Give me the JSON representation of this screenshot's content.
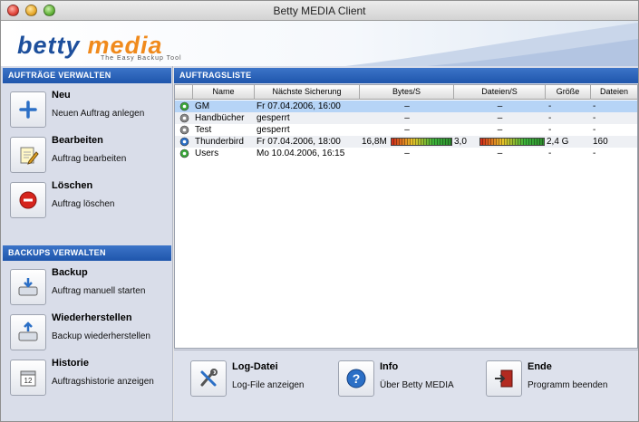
{
  "window": {
    "title": "Betty MEDIA Client"
  },
  "banner": {
    "logo_part1": "betty",
    "logo_part2": "media",
    "tagline": "The Easy Backup Tool"
  },
  "left": {
    "auftraege_header": "AUFTRÄGE VERWALTEN",
    "backups_header": "BACKUPS VERWALTEN",
    "actions": [
      {
        "title": "Neu",
        "desc": "Neuen Auftrag anlegen",
        "icon": "plus-icon"
      },
      {
        "title": "Bearbeiten",
        "desc": "Auftrag bearbeiten",
        "icon": "notepad-pencil-icon"
      },
      {
        "title": "Löschen",
        "desc": "Auftrag löschen",
        "icon": "delete-icon"
      },
      {
        "title": "Backup",
        "desc": "Auftrag manuell starten",
        "icon": "backup-drive-icon"
      },
      {
        "title": "Wiederherstellen",
        "desc": "Backup wiederherstellen",
        "icon": "restore-drive-icon"
      },
      {
        "title": "Historie",
        "desc": "Auftragshistorie anzeigen",
        "icon": "calendar-icon"
      }
    ]
  },
  "list": {
    "header": "AUFTRAGSLISTE",
    "columns": [
      "",
      "Name",
      "Nächste Sicherung",
      "Bytes/S",
      "Dateien/S",
      "Größe",
      "Dateien"
    ],
    "rows": [
      {
        "status": "active",
        "name": "GM",
        "next": "Fr 07.04.2006, 16:00",
        "bytes": "–",
        "files_s": "–",
        "size": "-",
        "files": "-",
        "selected": true
      },
      {
        "status": "locked",
        "name": "Handbücher",
        "next": "gesperrt",
        "bytes": "–",
        "files_s": "–",
        "size": "-",
        "files": "-",
        "selected": false
      },
      {
        "status": "locked",
        "name": "Test",
        "next": "gesperrt",
        "bytes": "–",
        "files_s": "–",
        "size": "-",
        "files": "-",
        "selected": false
      },
      {
        "status": "running",
        "name": "Thunderbird",
        "next": "Fr 07.04.2006, 18:00",
        "bytes": "16,8M",
        "files_s": "3,0",
        "size": "2,4 G",
        "files": "160",
        "selected": false,
        "bytes_level": 1.0,
        "files_level": 1.0
      },
      {
        "status": "active",
        "name": "Users",
        "next": "Mo 10.04.2006, 16:15",
        "bytes": "–",
        "files_s": "–",
        "size": "-",
        "files": "-",
        "selected": false
      }
    ]
  },
  "bottom": [
    {
      "title": "Log-Datei",
      "desc": "Log-File anzeigen",
      "icon": "tools-icon"
    },
    {
      "title": "Info",
      "desc": "Über Betty MEDIA",
      "icon": "help-icon"
    },
    {
      "title": "Ende",
      "desc": "Programm beenden",
      "icon": "exit-door-icon"
    }
  ],
  "colors": {
    "header_blue": "#2a62b8",
    "selection": "#b6d4f6",
    "logo_blue": "#1d4f9c",
    "logo_orange": "#f08a1c"
  }
}
